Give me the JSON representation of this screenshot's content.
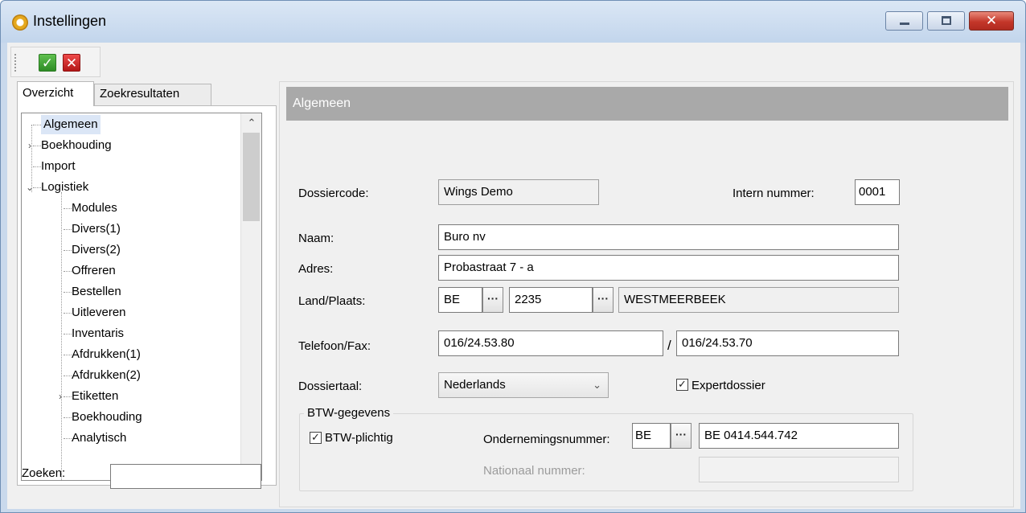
{
  "window": {
    "title": "Instellingen",
    "minimize_glyph": "",
    "close_glyph": "✕"
  },
  "toolbar": {
    "ok_glyph": "✓",
    "cancel_glyph": "✕"
  },
  "left": {
    "tabs": [
      "Overzicht",
      "Zoekresultaten"
    ],
    "tree": [
      {
        "label": "Algemeen",
        "level": 0,
        "selected": true,
        "expander": ""
      },
      {
        "label": "Boekhouding",
        "level": 0,
        "expander": "›"
      },
      {
        "label": "Import",
        "level": 0,
        "expander": ""
      },
      {
        "label": "Logistiek",
        "level": 0,
        "expander": "⌄"
      },
      {
        "label": "Modules",
        "level": 1,
        "expander": ""
      },
      {
        "label": "Divers(1)",
        "level": 1,
        "expander": ""
      },
      {
        "label": "Divers(2)",
        "level": 1,
        "expander": ""
      },
      {
        "label": "Offreren",
        "level": 1,
        "expander": ""
      },
      {
        "label": "Bestellen",
        "level": 1,
        "expander": ""
      },
      {
        "label": "Uitleveren",
        "level": 1,
        "expander": ""
      },
      {
        "label": "Inventaris",
        "level": 1,
        "expander": ""
      },
      {
        "label": "Afdrukken(1)",
        "level": 1,
        "expander": ""
      },
      {
        "label": "Afdrukken(2)",
        "level": 1,
        "expander": ""
      },
      {
        "label": "Etiketten",
        "level": 1,
        "expander": "›"
      },
      {
        "label": "Boekhouding",
        "level": 1,
        "expander": ""
      },
      {
        "label": "Analytisch",
        "level": 1,
        "expander": ""
      }
    ],
    "scroll_up": "⌃",
    "scroll_down": "⌄",
    "search_label": "Zoeken:",
    "search_value": ""
  },
  "main": {
    "header": "Algemeen",
    "dossiercode_label": "Dossiercode:",
    "dossiercode_value": "Wings Demo",
    "intern_label": "Intern nummer:",
    "intern_value": "0001",
    "naam_label": "Naam:",
    "naam_value": "Buro nv",
    "adres_label": "Adres:",
    "adres_value": "Probastraat 7 - a",
    "land_label": "Land/Plaats:",
    "land_value": "BE",
    "postcode_value": "2235",
    "plaats_value": "WESTMEERBEEK",
    "ellipsis": "···",
    "telefoon_label": "Telefoon/Fax:",
    "telefoon_value": "016/24.53.80",
    "fax_separator": "/",
    "fax_value": "016/24.53.70",
    "taal_label": "Dossiertaal:",
    "taal_value": "Nederlands",
    "combo_arrow": "⌄",
    "expert_label": "Expertdossier",
    "expert_checked": true,
    "check_glyph": "✓",
    "btw_group_title": "BTW-gegevens",
    "btw_plichtig_label": "BTW-plichtig",
    "btw_plichtig_checked": true,
    "ondernemingsnummer_label": "Ondernemingsnummer:",
    "ondernemingsnummer_country": "BE",
    "ondernemingsnummer_value": "BE 0414.544.742",
    "nationaal_label": "Nationaal nummer:",
    "nationaal_value": ""
  }
}
